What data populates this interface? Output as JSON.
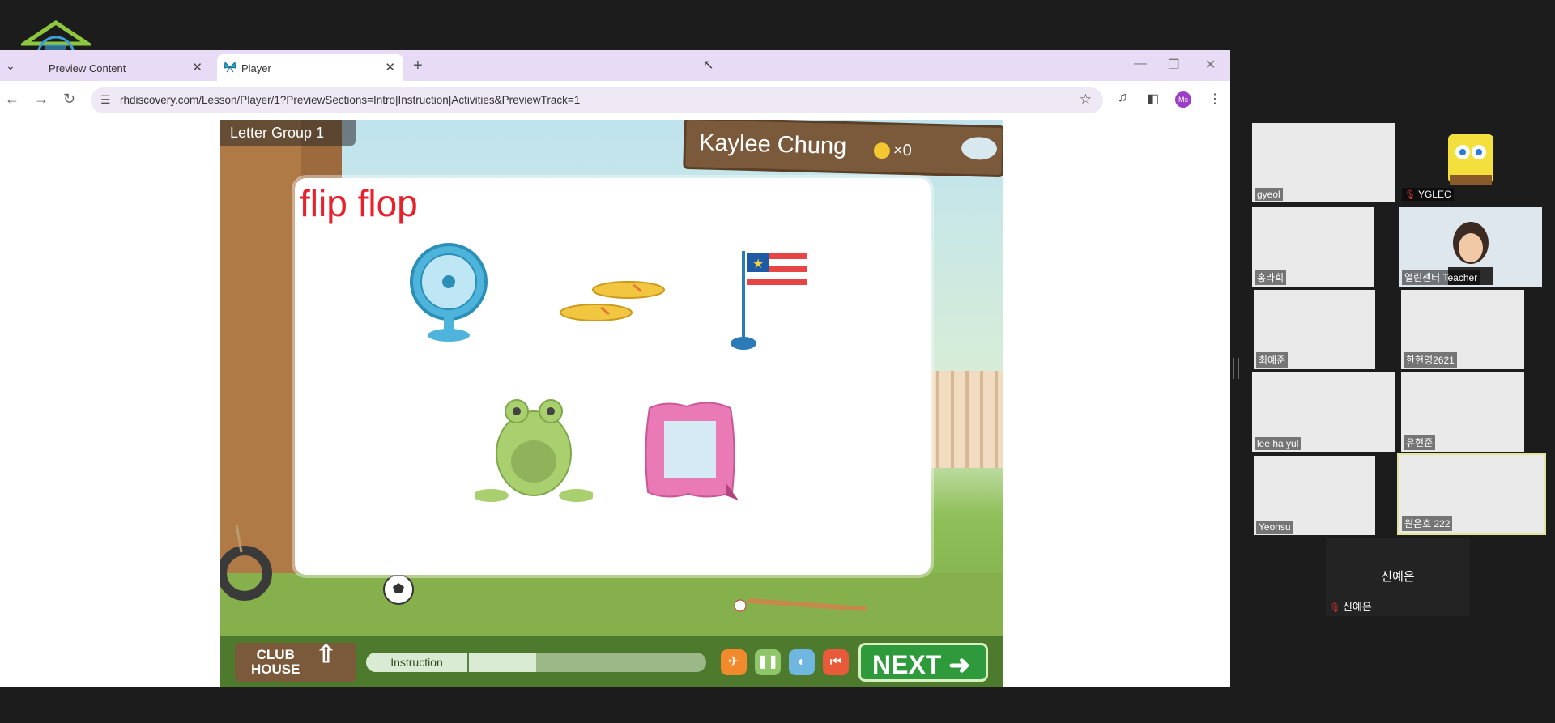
{
  "browser": {
    "tabs": [
      {
        "label": "Preview Content",
        "close": "✕"
      },
      {
        "label": "Player",
        "close": "✕"
      }
    ],
    "new_tab": "+",
    "window_controls": {
      "minimize": "—",
      "restore": "❐",
      "close": "✕"
    },
    "nav": {
      "back": "←",
      "forward": "→",
      "reload": "↻"
    },
    "url": "rhdiscovery.com/Lesson/Player/1?PreviewSections=Intro|Instruction|Activities&PreviewTrack=1",
    "profile_initials": "Ms",
    "menu": "⋮"
  },
  "game": {
    "group_label": "Letter Group 1",
    "student_name": "Kaylee Chung",
    "coin_count": "×0",
    "word": "flip flop",
    "pictures": [
      "fan",
      "flip flops",
      "flag",
      "frog",
      "frame"
    ],
    "club_house": [
      "CLUB",
      "HOUSE"
    ],
    "progress_label": "Instruction",
    "progress_fraction": 0.5,
    "next_label": "NEXT ➜",
    "colors": {
      "word": "#e8212b",
      "next": "#2f9a3c"
    }
  },
  "participants": [
    {
      "name": "gyeol",
      "video": true
    },
    {
      "name": "YGLEC",
      "video": true,
      "muted": true
    },
    {
      "name": "홍라희",
      "video": true
    },
    {
      "name": "열린센터 Teacher",
      "video": true
    },
    {
      "name": "최예준",
      "video": true
    },
    {
      "name": "한현영2621",
      "video": true
    },
    {
      "name": "lee ha yul",
      "video": true
    },
    {
      "name": "유현준",
      "video": true
    },
    {
      "name": "Yeonsu",
      "video": true
    },
    {
      "name": "원은호 222",
      "video": true,
      "active": true
    },
    {
      "name": "신예은",
      "video": false,
      "muted": true
    }
  ],
  "no_video_display": "신예은"
}
